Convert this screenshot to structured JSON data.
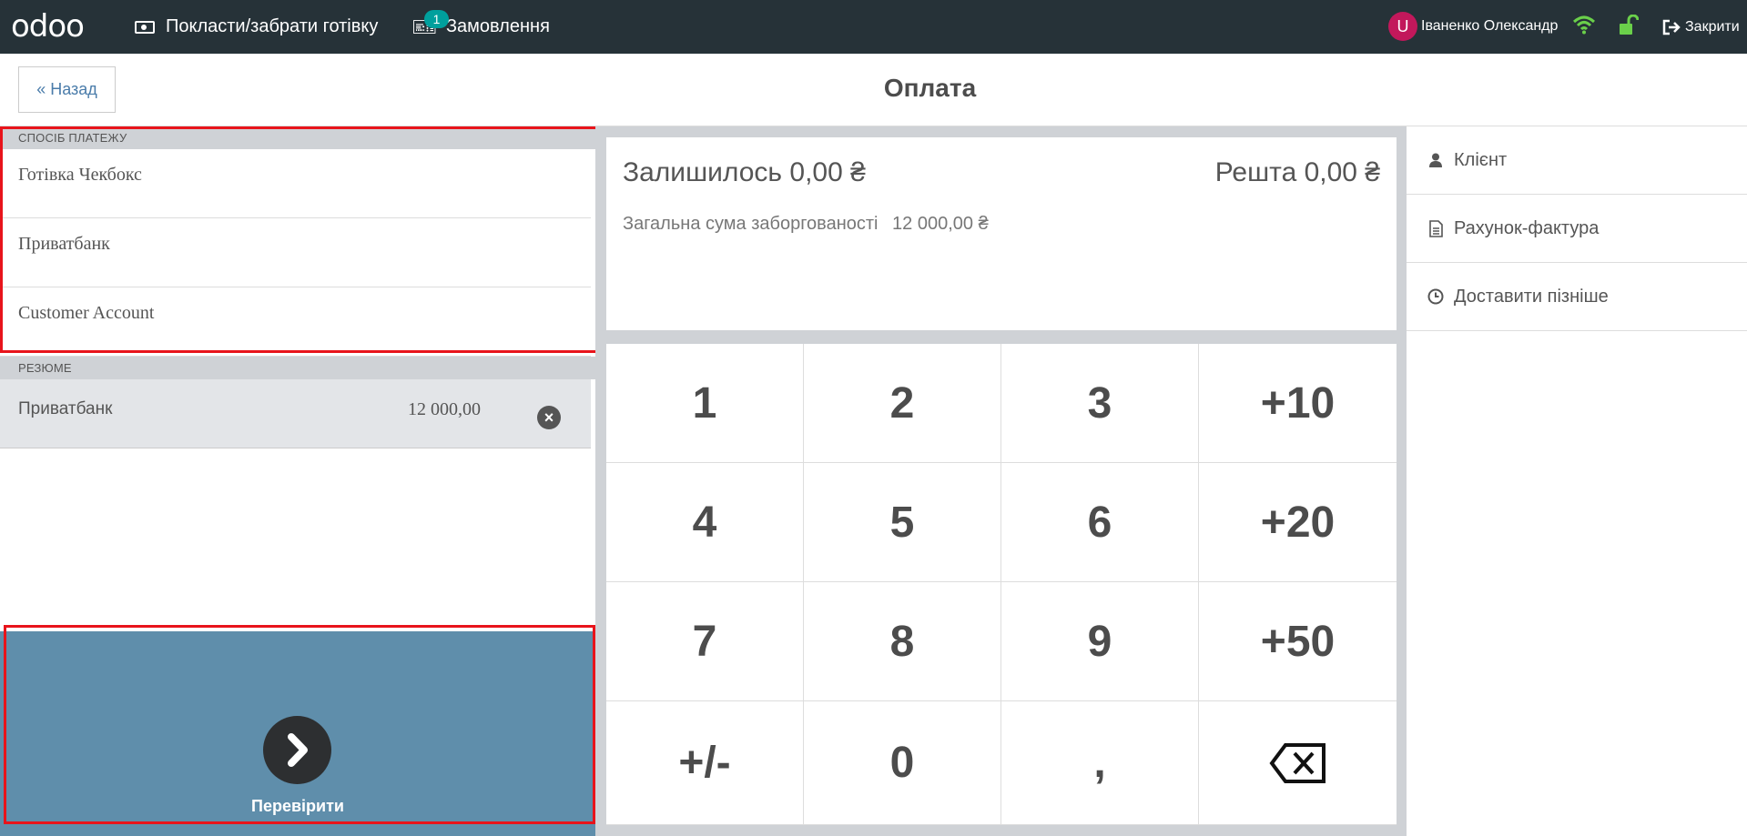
{
  "topbar": {
    "logo": "odoo",
    "cash_label": "Покласти/забрати готівку",
    "orders_label": "Замовлення",
    "orders_count": "1",
    "user_initial": "U",
    "user_name": "Іваненко Олександр",
    "close_label": "Закрити"
  },
  "header": {
    "back_label": "« Назад",
    "title": "Оплата"
  },
  "payment_methods": {
    "heading": "СПОСІБ ПЛАТЕЖУ",
    "items": [
      "Готівка Чекбокс",
      "Приватбанк",
      "Customer Account"
    ]
  },
  "summary": {
    "heading": "РЕЗЮМЕ",
    "line": {
      "method": "Приватбанк",
      "amount": "12 000,00"
    }
  },
  "validate": {
    "label": "Перевірити"
  },
  "status": {
    "remaining": "Залишилось 0,00 ₴",
    "change": "Решта 0,00 ₴",
    "debt_label": "Загальна сума заборгованості",
    "debt_amount": "12 000,00 ₴"
  },
  "numpad": {
    "keys": [
      "1",
      "2",
      "3",
      "+10",
      "4",
      "5",
      "6",
      "+20",
      "7",
      "8",
      "9",
      "+50",
      "+/-",
      "0",
      ",",
      "backspace"
    ]
  },
  "right_panel": {
    "customer": "Клієнт",
    "invoice": "Рахунок-фактура",
    "ship_later": "Доставити пізніше"
  },
  "colors": {
    "topbar": "#263238",
    "validate": "#5f8eab",
    "highlight": "#e8141b",
    "badge": "#00a09d"
  }
}
